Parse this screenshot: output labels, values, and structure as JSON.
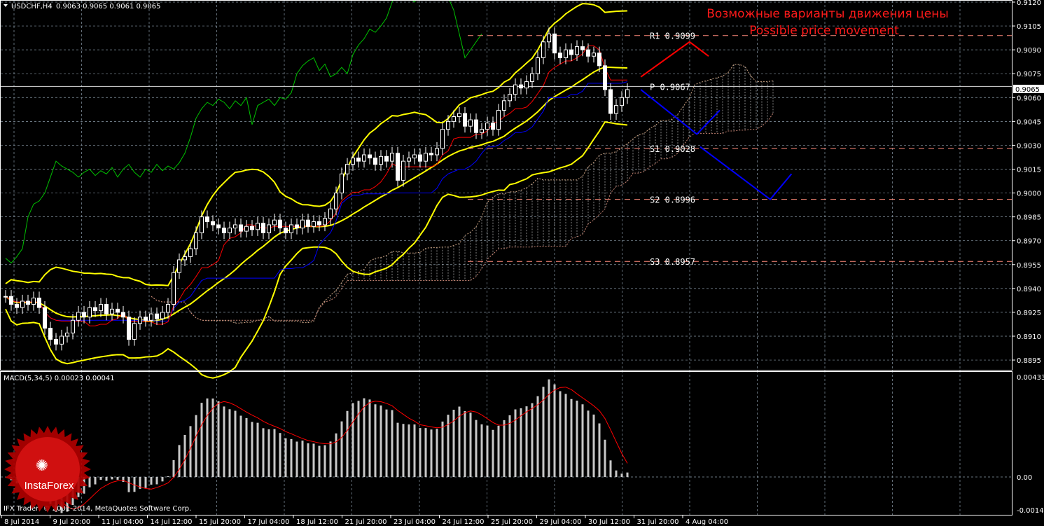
{
  "header": {
    "symbol": "USDCHF,H4",
    "ohlc": "0.9063 0.9065 0.9061 0.9065"
  },
  "title_ru": "Возможные варианты движения цены",
  "title_en": "Possible price movement",
  "macd_label": "MACD(5,34,5) 0.00023 0.00041",
  "copyright": "IFX Trader, © 2001-2014, MetaQuotes Software Corp.",
  "logo": "InstaForex",
  "current_price": "0.9065",
  "colors": {
    "bg": "#000000",
    "grid": "#8a9aa8",
    "bull": "#ffffff",
    "bear": "#ffffff",
    "bands": "#ffff00",
    "tenkan": "#ff0000",
    "kijun": "#0000ff",
    "chikou": "#00c000",
    "levels": "#ff8a7a",
    "title": "#ff1a1a"
  },
  "chart_data": {
    "type": "candlestick",
    "price_ticks": [
      "0.9120",
      "0.9105",
      "0.9090",
      "0.9075",
      "0.9060",
      "0.9045",
      "0.9030",
      "0.9015",
      "0.9000",
      "0.8985",
      "0.8970",
      "0.8955",
      "0.8940",
      "0.8925",
      "0.8910",
      "0.8895"
    ],
    "price_range": [
      0.88925,
      0.9121
    ],
    "macd_ticks": [
      "0.00433",
      "0.00",
      "-0.00143"
    ],
    "macd_range": [
      -0.00143,
      0.00433
    ],
    "time_labels": [
      "8 Jul 2014",
      "9 Jul 20:00",
      "11 Jul 04:00",
      "14 Jul 12:00",
      "15 Jul 20:00",
      "17 Jul 04:00",
      "18 Jul 12:00",
      "21 Jul 20:00",
      "23 Jul 04:00",
      "24 Jul 12:00",
      "25 Jul 20:00",
      "29 Jul 04:00",
      "30 Jul 12:00",
      "31 Jul 20:00",
      "4 Aug 04:00"
    ],
    "closes": [
      0.8935,
      0.893,
      0.8928,
      0.8932,
      0.893,
      0.8934,
      0.8928,
      0.8915,
      0.8908,
      0.8905,
      0.891,
      0.8912,
      0.892,
      0.8925,
      0.8922,
      0.8928,
      0.8926,
      0.893,
      0.8924,
      0.8927,
      0.8925,
      0.8922,
      0.8908,
      0.8918,
      0.8922,
      0.892,
      0.8924,
      0.8921,
      0.8925,
      0.893,
      0.895,
      0.8958,
      0.896,
      0.8965,
      0.8975,
      0.8985,
      0.8982,
      0.898,
      0.8978,
      0.8975,
      0.8978,
      0.898,
      0.8976,
      0.8979,
      0.8977,
      0.8981,
      0.8975,
      0.898,
      0.8983,
      0.8978,
      0.8975,
      0.898,
      0.8978,
      0.8983,
      0.8979,
      0.8982,
      0.898,
      0.8984,
      0.899,
      0.9,
      0.9012,
      0.9018,
      0.9022,
      0.902,
      0.9024,
      0.9022,
      0.9018,
      0.9023,
      0.902,
      0.9025,
      0.9008,
      0.902,
      0.9022,
      0.9024,
      0.902,
      0.9025,
      0.9024,
      0.9028,
      0.904,
      0.9045,
      0.9048,
      0.905,
      0.9042,
      0.9046,
      0.9038,
      0.904,
      0.9044,
      0.904,
      0.9052,
      0.9058,
      0.9062,
      0.9068,
      0.9066,
      0.907,
      0.9075,
      0.9085,
      0.9095,
      0.91,
      0.9088,
      0.9085,
      0.909,
      0.9087,
      0.9092,
      0.909,
      0.9086,
      0.9088,
      0.908,
      0.9065,
      0.905,
      0.9055,
      0.906,
      0.9065
    ],
    "pivots": [
      {
        "label": "R1",
        "value": "0.9099",
        "price": 0.9099
      },
      {
        "label": "P",
        "value": "0.9067",
        "price": 0.9067
      },
      {
        "label": "S1",
        "value": "0.9028",
        "price": 0.9028
      },
      {
        "label": "S2",
        "value": "0.8996",
        "price": 0.8996
      },
      {
        "label": "S3",
        "value": "0.8957",
        "price": 0.8957
      }
    ],
    "scenarios": [
      {
        "color": "#ff0000",
        "points": [
          [
            113.4,
            0.9073
          ],
          [
            122.1,
            0.9095
          ],
          [
            125.5,
            0.9086
          ]
        ]
      },
      {
        "color": "#0000ff",
        "points": [
          [
            113.4,
            0.9065
          ],
          [
            123.4,
            0.9037
          ],
          [
            127.5,
            0.9052
          ]
        ]
      },
      {
        "color": "#0000ff",
        "points": [
          [
            124,
            0.9029
          ],
          [
            136.5,
            0.8996
          ],
          [
            140.3,
            0.9012
          ]
        ]
      }
    ]
  }
}
